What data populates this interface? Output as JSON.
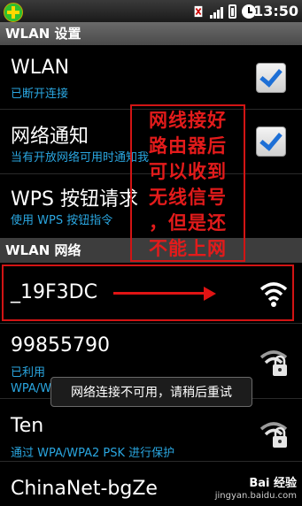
{
  "status_bar": {
    "time": "13:50"
  },
  "screen_title": "WLAN 设置",
  "settings": [
    {
      "title": "WLAN",
      "subtitle": "已断开连接",
      "checked": true
    },
    {
      "title": "网络通知",
      "subtitle": "当有开放网络可用时通知我",
      "checked": true
    },
    {
      "title": "WPS 按钮请求",
      "subtitle": "使用 WPS 按钮指令"
    }
  ],
  "section_header": "WLAN 网络",
  "networks": [
    {
      "ssid": "_19F3DC"
    },
    {
      "ssid": "99855790",
      "status": "已利用",
      "security": "WPA/WPA2 PSK 加密（WPS 可用）"
    },
    {
      "ssid": "Ten",
      "security": "通过 WPA/WPA2 PSK 进行保护"
    },
    {
      "ssid": "ChinaNet-bgZe"
    }
  ],
  "annotation": {
    "lines": [
      "网线接好",
      "路由器后",
      "可以收到",
      "无线信号",
      "，但是还",
      "不能上网"
    ],
    "color": "#e31b1b"
  },
  "toast": "网络连接不可用，请稍后重试",
  "watermark": {
    "brand": "Bai 经验",
    "url": "jingyan.baidu.com"
  },
  "colors": {
    "accent": "#2aa6e0",
    "annotation": "#d21414"
  }
}
